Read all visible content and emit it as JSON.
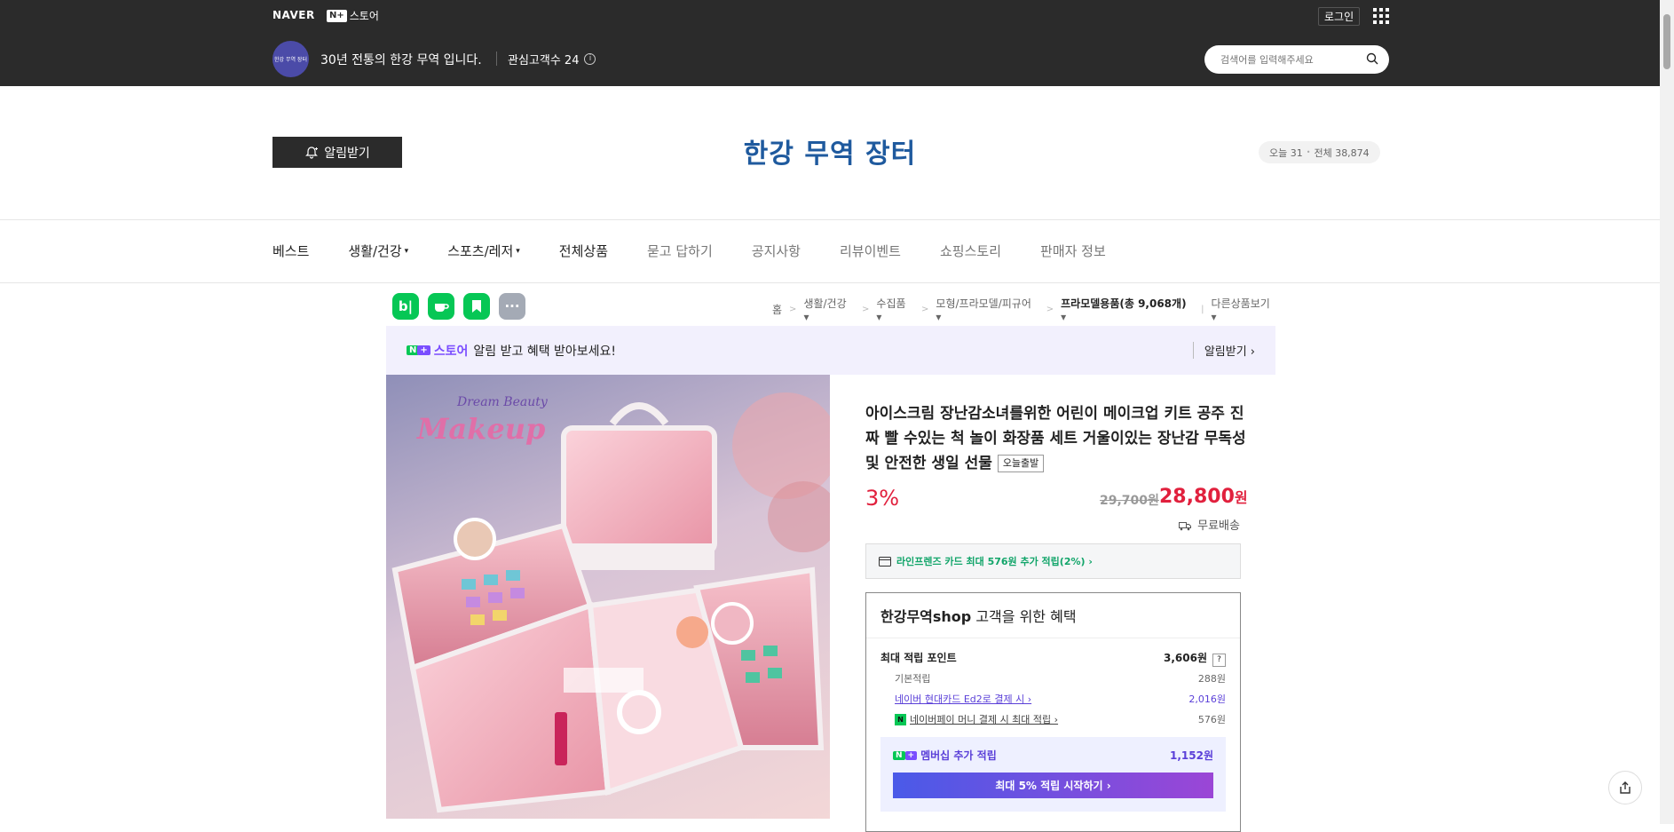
{
  "topbar": {
    "naver": "NAVER",
    "np_badge": "N+",
    "store_label": "스토어",
    "login": "로그인",
    "store_avatar_text": "한강 무역 장터",
    "store_name": "30년 전통의 한강 무역 입니다.",
    "interest_label": "관심고객수 24",
    "info_icon": "ⓘ"
  },
  "search": {
    "placeholder": "검색어를 입력해주세요"
  },
  "header": {
    "alarm_button": "알림받기",
    "logo_text": "한강 무역 장터",
    "visits_today": "오늘 31",
    "visits_dot": "•",
    "visits_total": "전체 38,874"
  },
  "nav": {
    "items": [
      {
        "label": "베스트"
      },
      {
        "label": "생활/건강"
      },
      {
        "label": "스포츠/레저"
      },
      {
        "label": "전체상품"
      },
      {
        "label": "묻고 답하기"
      },
      {
        "label": "공지사항"
      },
      {
        "label": "리뷰이벤트"
      },
      {
        "label": "쇼핑스토리"
      },
      {
        "label": "판매자 정보"
      }
    ]
  },
  "sns": {
    "blog": "b|",
    "more": "···"
  },
  "breadcrumb": {
    "items": [
      "홈",
      "생활/건강",
      "수집품",
      "모형/프라모델/피규어",
      "프라모델용품(총 9,068개)"
    ],
    "other": "다른상품보기"
  },
  "banner": {
    "store": "스토어",
    "text": "알림 받고 혜택 받아보세요!",
    "right": "알림받기 ›"
  },
  "product": {
    "image_title": "Dream Beauty",
    "image_script": "Makeup",
    "title": "아이스크림 장난감소녀를위한 어린이 메이크업 키트 공주 진짜 빨 수있는 척 놀이 화장품 세트 거울이있는 장난감 무독성 및 안전한 생일 선물",
    "badge": "오늘출발",
    "discount": "3%",
    "old_price": "29,700원",
    "new_price": "28,800",
    "currency": "원",
    "shipping": "무료배송",
    "card_benefit": "라인프렌즈 카드 최대 576원 추가 적립(2%) ›"
  },
  "benefit": {
    "title_prefix": "한강무역",
    "title_bold": "shop",
    "title_suffix": " 고객을 위한 혜택",
    "max_points_label": "최대 적립 포인트",
    "max_points_value": "3,606원",
    "qmark": "?",
    "rows": [
      {
        "label": "기본적립",
        "value": "288원"
      },
      {
        "label": "네이버 현대카드 Ed2로 결제 시 ›",
        "value": "2,016원"
      },
      {
        "label": "네이버페이 머니 결제 시 최대 적립 ›",
        "value": "576원"
      }
    ],
    "membership_label": "멤버십 추가 적립",
    "membership_value": "1,152원",
    "membership_button": "최대 5% 적립 시작하기 ›"
  },
  "colors": {
    "topbar": "#2b2b2b",
    "price_red": "#e1203d",
    "naver_green": "#06c755",
    "plus_purple": "#7a4dff",
    "logo_blue": "#1f5a9e"
  }
}
